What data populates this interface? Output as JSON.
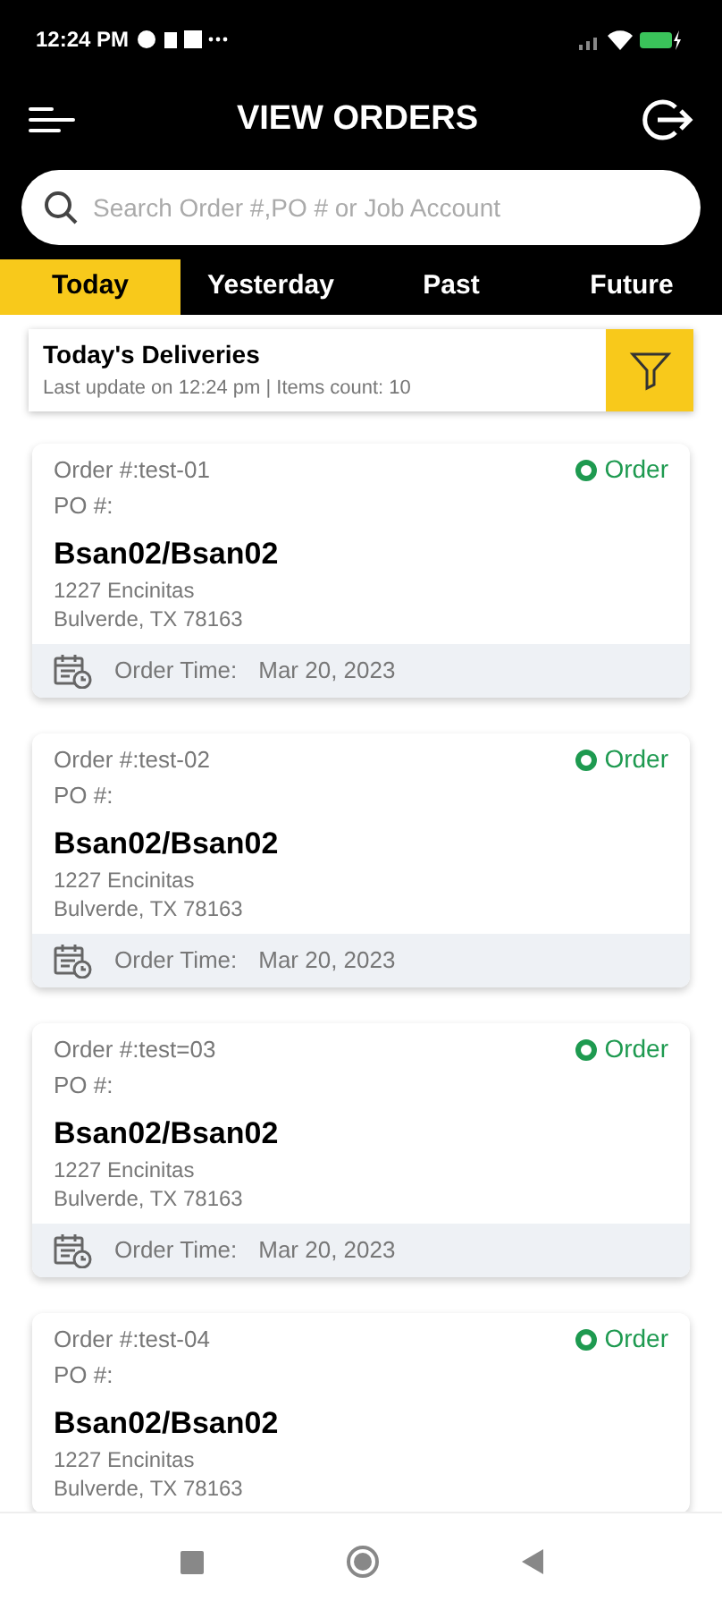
{
  "status_bar": {
    "time": "12:24 PM"
  },
  "header": {
    "title": "VIEW ORDERS"
  },
  "search": {
    "placeholder": "Search Order #,PO # or Job Account"
  },
  "tabs": [
    {
      "label": "Today",
      "selected": true
    },
    {
      "label": "Yesterday",
      "selected": false
    },
    {
      "label": "Past",
      "selected": false
    },
    {
      "label": "Future",
      "selected": false
    }
  ],
  "summary": {
    "title": "Today's Deliveries",
    "subtitle": "Last update on 12:24 pm | Items count: 10"
  },
  "orders": [
    {
      "order_no": "Order #:test-01",
      "po": "PO #:",
      "status": "Order",
      "color": "#1e9a50",
      "name": "Bsan02/Bsan02",
      "address": [
        "1227 Encinitas",
        "Bulverde, TX 78163"
      ],
      "time_label": "Order Time:",
      "time_value": "Mar 20, 2023"
    },
    {
      "order_no": "Order #:test-02",
      "po": "PO #:",
      "status": "Order",
      "color": "#1e9a50",
      "name": "Bsan02/Bsan02",
      "address": [
        "1227 Encinitas",
        "Bulverde, TX 78163"
      ],
      "time_label": "Order Time:",
      "time_value": "Mar 20, 2023"
    },
    {
      "order_no": "Order #:test=03",
      "po": "PO #:",
      "status": "Order",
      "color": "#1e9a50",
      "name": "Bsan02/Bsan02",
      "address": [
        "1227 Encinitas",
        "Bulverde, TX 78163"
      ],
      "time_label": "Order Time:",
      "time_value": "Mar 20, 2023"
    },
    {
      "order_no": "Order #:test-04",
      "po": "PO #:",
      "status": "Order",
      "color": "#1e9a50",
      "name": "Bsan02/Bsan02",
      "address": [
        "1227 Encinitas",
        "Bulverde, TX 78163"
      ]
    }
  ]
}
